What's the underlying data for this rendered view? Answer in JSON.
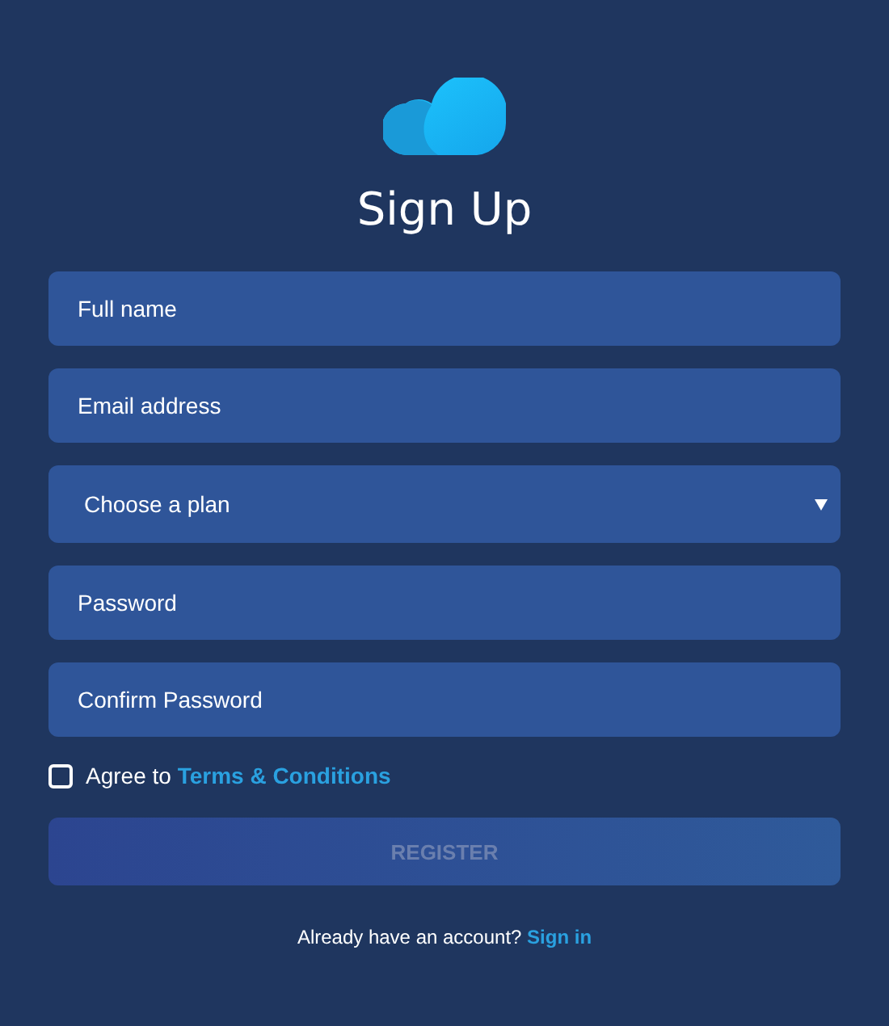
{
  "title": "Sign Up",
  "fields": [
    {
      "kind": "text",
      "placeholder": "Full name"
    },
    {
      "kind": "text",
      "placeholder": "Email address"
    },
    {
      "kind": "select",
      "placeholder": "Choose a plan"
    },
    {
      "kind": "password",
      "placeholder": "Password"
    },
    {
      "kind": "password",
      "placeholder": "Confirm Password"
    }
  ],
  "agree": {
    "checked": false,
    "label": "Agree to",
    "link": "Terms & Conditions"
  },
  "register": {
    "label": "REGISTER",
    "disabled": true
  },
  "footer": {
    "text": "Already have an account?",
    "link": "Sign in"
  }
}
